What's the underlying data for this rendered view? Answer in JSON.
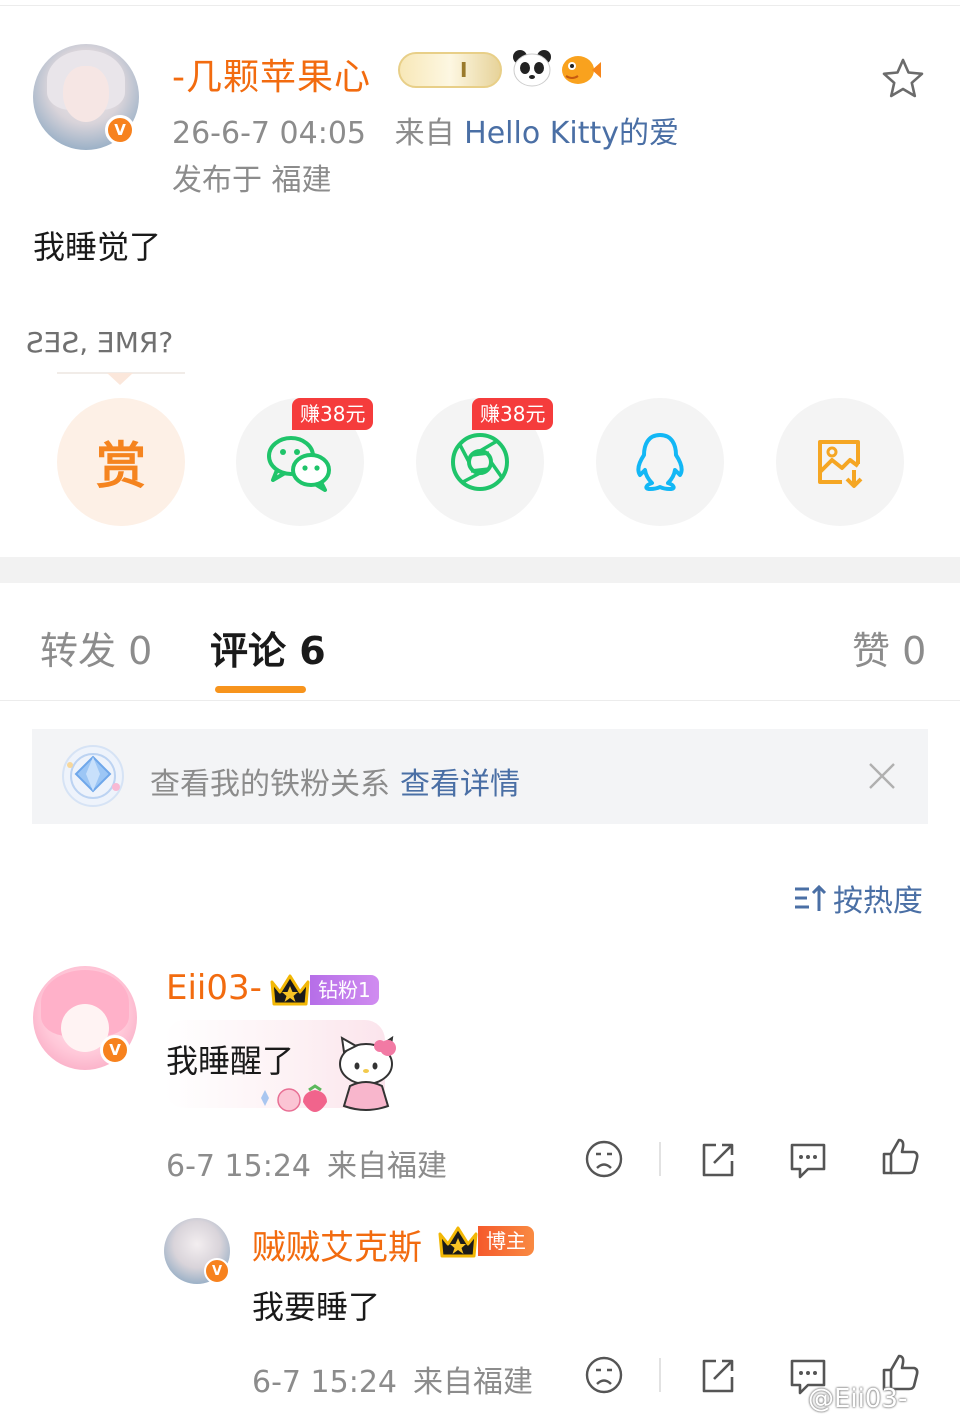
{
  "post": {
    "author": "-几颗苹果心",
    "fan_level": "I",
    "time": "26-6-7 04:05",
    "source_prefix": "来自",
    "source": "Hello Kitty的爱",
    "location": "发布于 福建",
    "text": "我睡觉了",
    "mirror_text": "ƧƎƧ, ƎMЯ?"
  },
  "share": {
    "reward_label": "赏",
    "wechat_badge": "赚38元",
    "moments_badge": "赚38元"
  },
  "tabs": {
    "repost": "转发 0",
    "comments": "评论 6",
    "likes": "赞 0"
  },
  "notice": {
    "text": "查看我的铁粉关系",
    "link": "查看详情"
  },
  "sort": {
    "label": "按热度"
  },
  "comments": [
    {
      "name": "Eii03-",
      "tag": "钻粉1",
      "text": "我睡醒了",
      "time": "6-7 15:24",
      "location": "来自福建"
    },
    {
      "name": "贼贼艾克斯",
      "tag": "博主",
      "text": "我要睡了",
      "time": "6-7 15:24",
      "location": "来自福建"
    }
  ],
  "watermark": "@Eii03-",
  "colors": {
    "brand_orange": "#f26b0f",
    "link_blue": "#4a6fa5",
    "tab_underline": "#f7941d",
    "earn_red": "#f53c3c"
  }
}
